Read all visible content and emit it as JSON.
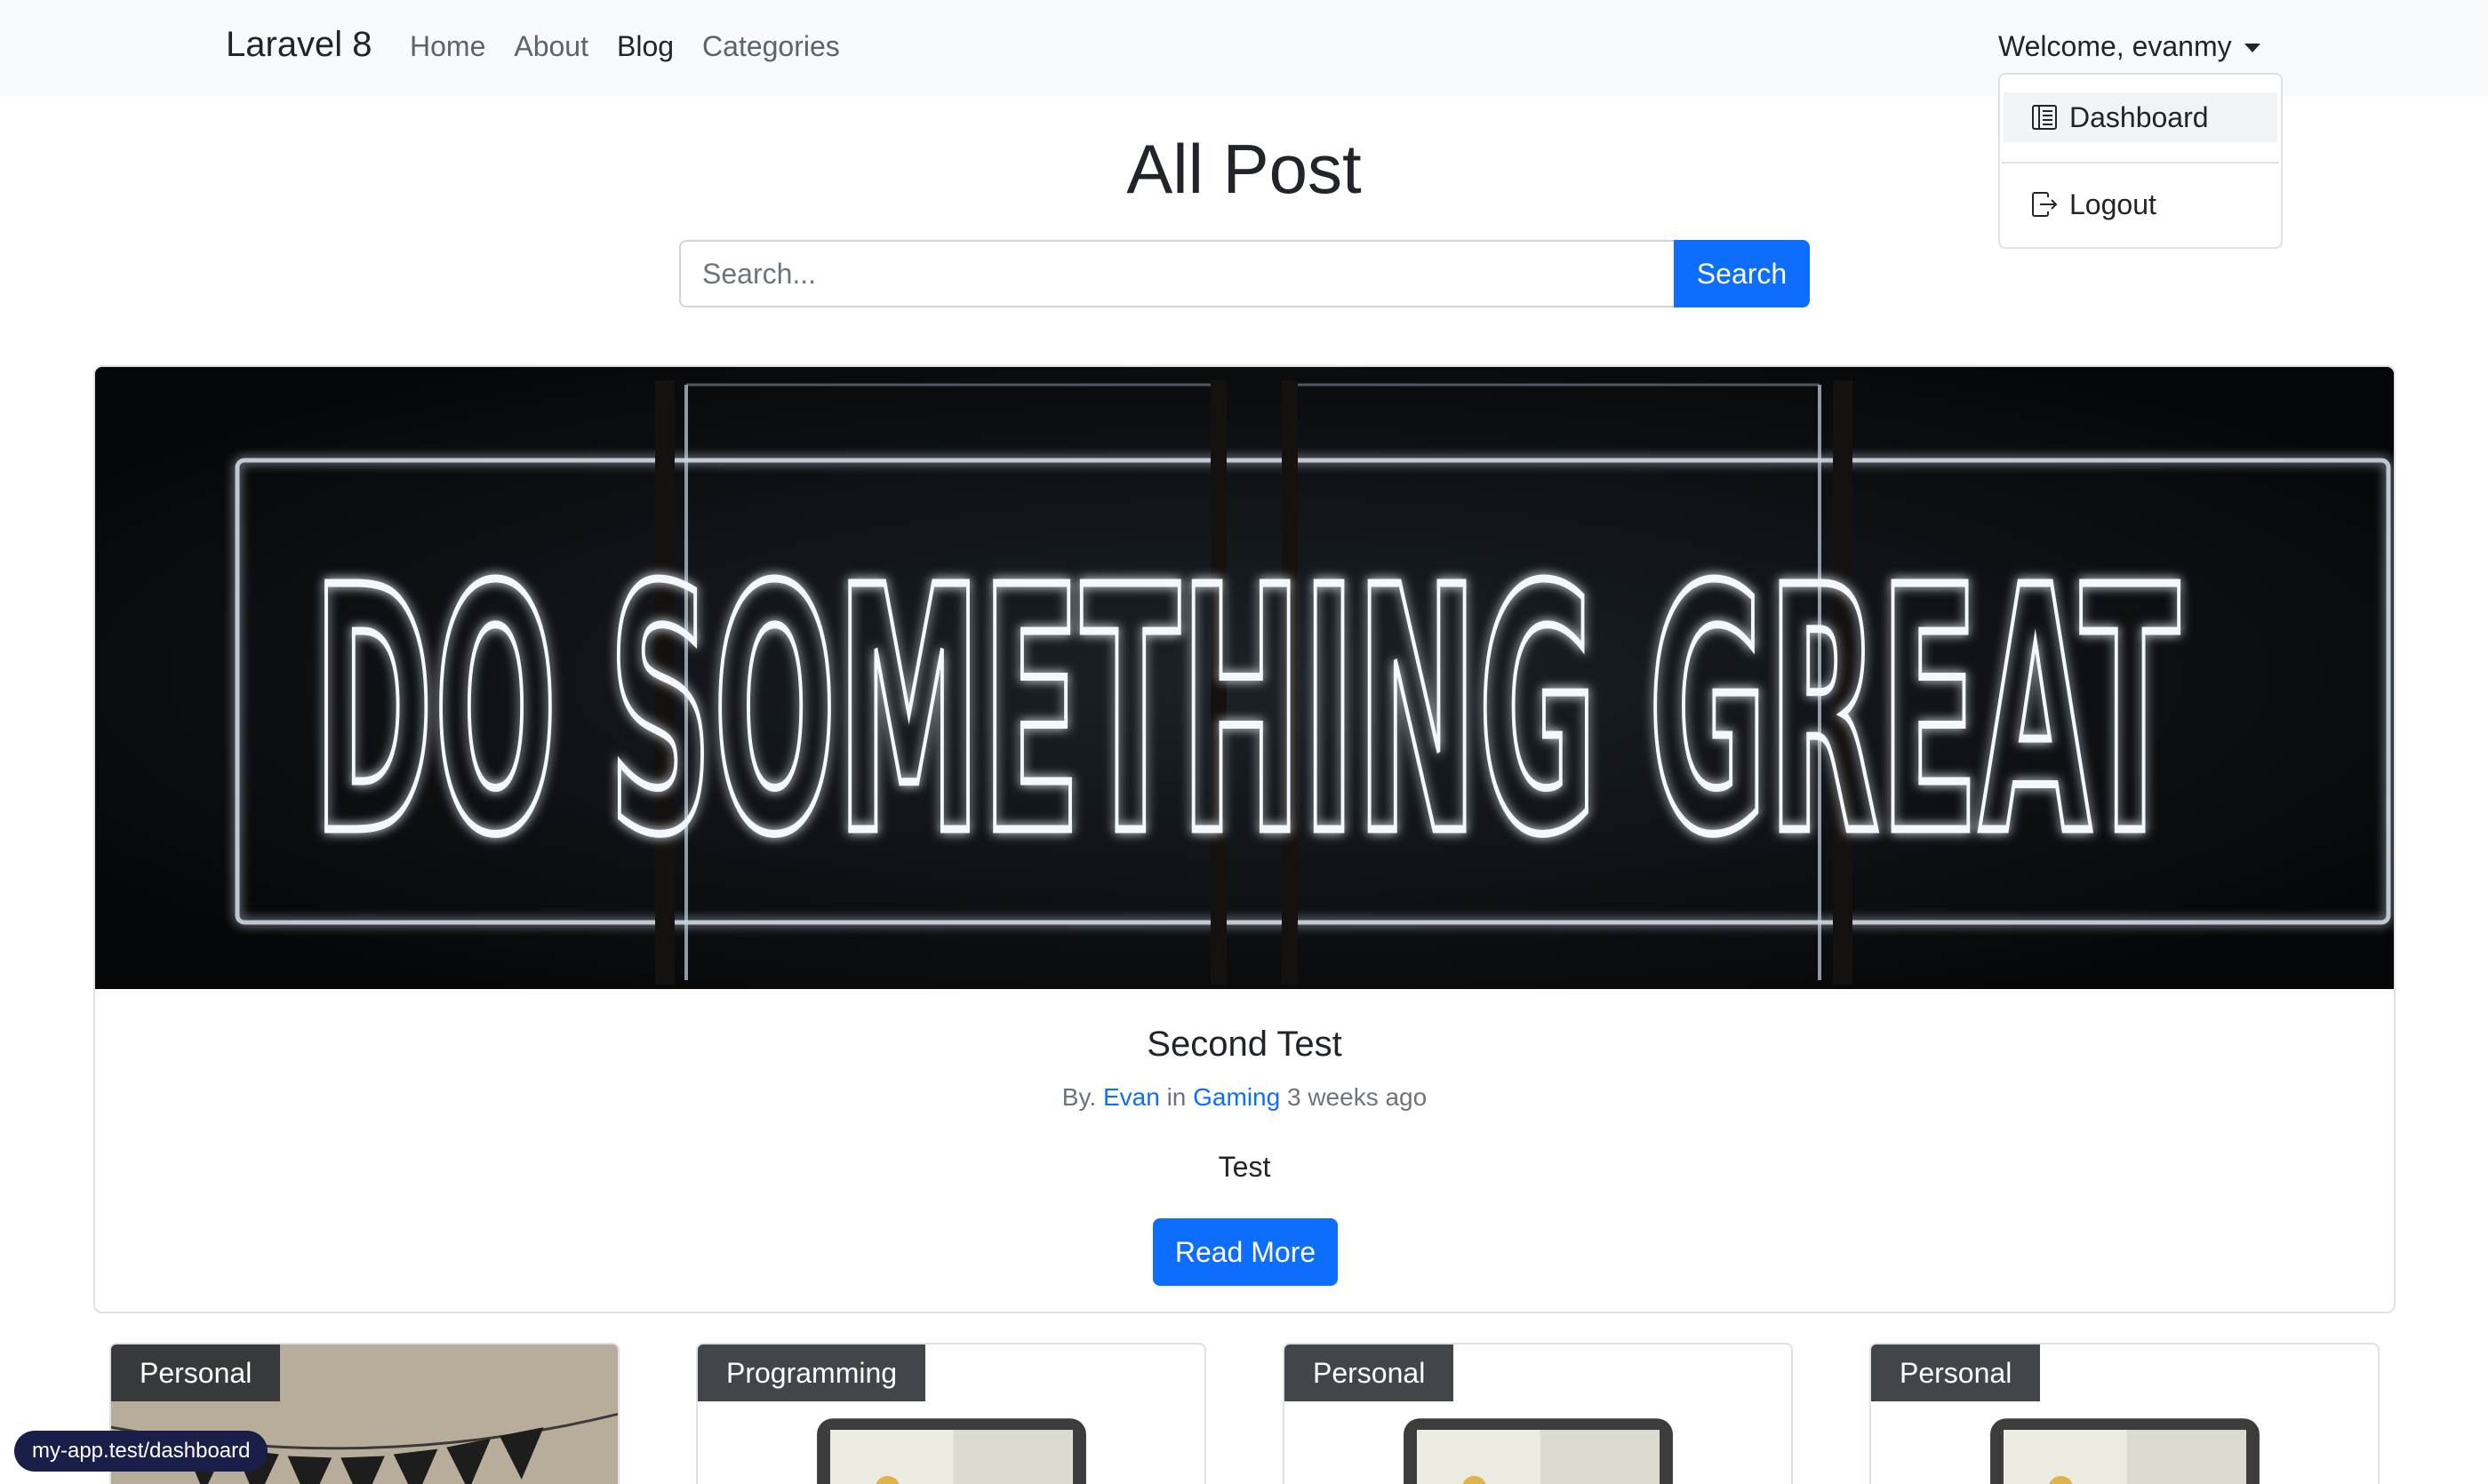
{
  "navbar": {
    "brand": "Laravel 8",
    "links": [
      {
        "label": "Home"
      },
      {
        "label": "About"
      },
      {
        "label": "Blog"
      },
      {
        "label": "Categories"
      }
    ],
    "welcome": "Welcome, evanmy"
  },
  "dropdown": {
    "items": [
      {
        "label": "Dashboard",
        "icon": "dashboard-icon"
      },
      {
        "label": "Logout",
        "icon": "logout-icon"
      }
    ]
  },
  "page": {
    "title": "All Post"
  },
  "search": {
    "placeholder": "Search...",
    "button_label": "Search"
  },
  "featured": {
    "image_text": "DO SOMETHING GREAT",
    "title": "Second Test",
    "by_prefix": "By.",
    "author": "Evan",
    "in_word": "in",
    "category": "Gaming",
    "time_ago": "3 weeks ago",
    "excerpt": "Test",
    "read_more_label": "Read More"
  },
  "posts": [
    {
      "category": "Personal"
    },
    {
      "category": "Programming"
    },
    {
      "category": "Personal"
    },
    {
      "category": "Personal"
    }
  ],
  "status_bar": {
    "url": "my-app.test/dashboard"
  },
  "colors": {
    "primary": "#0d6efd",
    "navbar_bg": "#f8f9fa",
    "text": "#212529",
    "muted": "#6c757d"
  }
}
